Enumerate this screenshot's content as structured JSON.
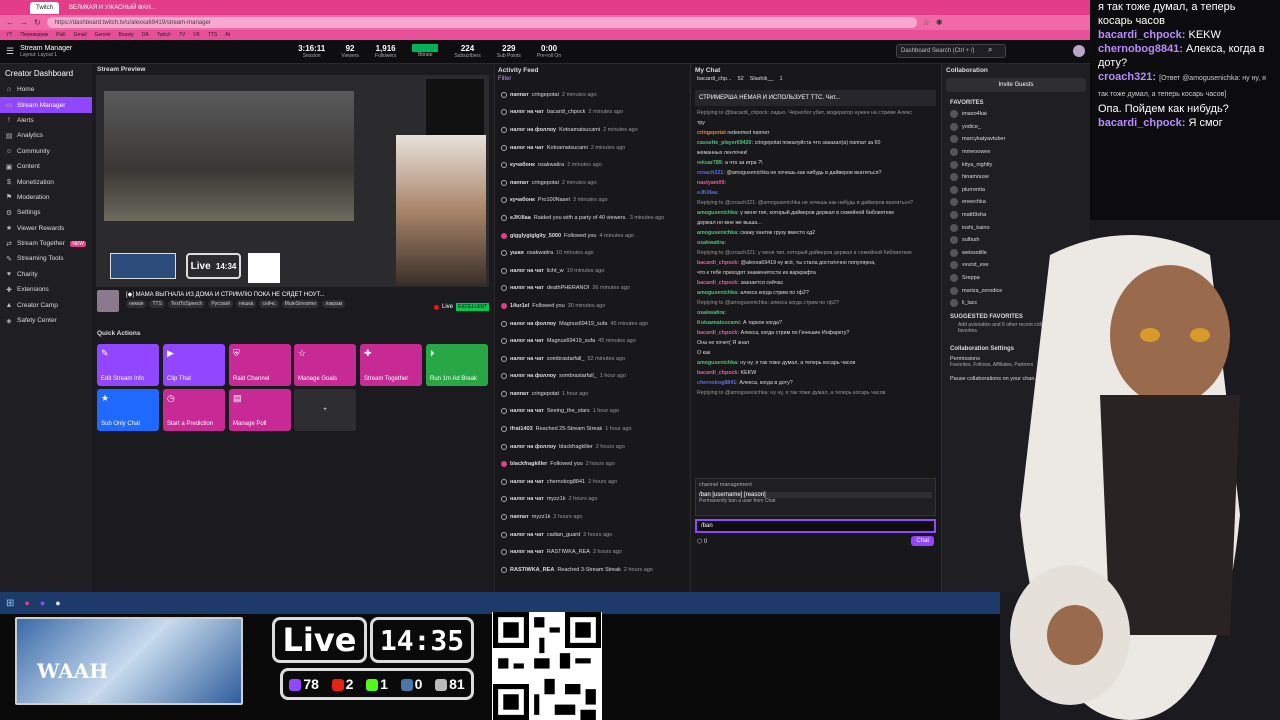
{
  "browser": {
    "tabs": [
      {
        "label": "Twitch",
        "active": true
      },
      {
        "label": "ВЕЛИКАЯ И УЖАСНЫЙ ФАН…",
        "active": false
      }
    ],
    "url": "https://dashboard.twitch.tv/u/alexxa69419/stream-manager",
    "bookmarks": [
      "YT",
      "Переводчик",
      "PoE",
      "Gmail",
      "Gemini",
      "Boosty",
      "DA",
      "Twitch",
      "TV",
      "VK",
      "TTS",
      "AI"
    ]
  },
  "topbar": {
    "title": "Stream Manager",
    "subtitle": "Layout: Layout 1",
    "stats": [
      {
        "value": "3:16:11",
        "label": "Session"
      },
      {
        "value": "92",
        "label": "Viewers"
      },
      {
        "value": "1,916",
        "label": "Followers"
      },
      {
        "value": "",
        "label": "Bitrate"
      },
      {
        "value": "224",
        "label": "Subscribers"
      },
      {
        "value": "229",
        "label": "Sub Points"
      },
      {
        "value": "0:00",
        "label": "Pre-roll On"
      }
    ],
    "search_placeholder": "Dashboard Search (Ctrl + /)"
  },
  "sidebar": {
    "title": "Creator Dashboard",
    "items": [
      {
        "label": "Home",
        "icon": "home-icon"
      },
      {
        "label": "Stream Manager",
        "icon": "stream-manager-icon",
        "active": true
      },
      {
        "label": "Alerts",
        "icon": "alerts-icon"
      },
      {
        "label": "Analytics",
        "icon": "analytics-icon"
      },
      {
        "label": "Community",
        "icon": "community-icon"
      },
      {
        "label": "Content",
        "icon": "content-icon"
      },
      {
        "label": "Monetization",
        "icon": "monetization-icon"
      },
      {
        "label": "Moderation",
        "icon": "moderation-icon"
      },
      {
        "label": "Settings",
        "icon": "settings-icon"
      },
      {
        "label": "Viewer Rewards",
        "icon": "rewards-icon"
      },
      {
        "label": "Stream Together",
        "icon": "stream-together-icon",
        "badge": "NEW"
      },
      {
        "label": "Streaming Tools",
        "icon": "tools-icon"
      },
      {
        "label": "Charity",
        "icon": "charity-icon"
      },
      {
        "label": "Extensions",
        "icon": "extensions-icon"
      },
      {
        "label": "Creator Camp",
        "icon": "camp-icon"
      },
      {
        "label": "Safety Center",
        "icon": "safety-icon"
      }
    ]
  },
  "preview": {
    "header": "Stream Preview",
    "stream_title": "[◆] МАМА ВЫГНАЛА ИЗ ДОМА И СТРИМЛЮ ПОКА НЕ СЯДЕТ НОУТ...",
    "tags": [
      "немая",
      "TTS",
      "TextToSpeech",
      "Русский",
      "няшка",
      "сейчс",
      "MuteStreamer",
      "лакрам"
    ],
    "live_label": "Live",
    "quality": "EXCELLENT"
  },
  "quick_actions": {
    "header": "Quick Actions",
    "items": [
      {
        "label": "Edit Stream Info",
        "color": "#9147ff"
      },
      {
        "label": "Clip That",
        "color": "#9147ff"
      },
      {
        "label": "Raid Channel",
        "color": "#c72a94"
      },
      {
        "label": "Manage Goals",
        "color": "#c72a94"
      },
      {
        "label": "Stream Together",
        "color": "#c72a94"
      },
      {
        "label": "Run 1m Ad Break",
        "color": "#28a745"
      },
      {
        "label": "Sub Only Chat",
        "color": "#1f69ff"
      },
      {
        "label": "Start a Prediction",
        "color": "#c72a94"
      },
      {
        "label": "Manage Poll",
        "color": "#c72a94"
      },
      {
        "label": "+",
        "color": "#2e2e32"
      }
    ]
  },
  "activity": {
    "header": "Activity Feed",
    "filter": "Filter",
    "rows": [
      {
        "user": "паппат",
        "text": "cringepotat",
        "time": "2 minutes ago",
        "heart": false
      },
      {
        "user": "налог на чат",
        "text": "bacardi_chpock",
        "time": "2 minutes ago",
        "heart": false
      },
      {
        "user": "налог на фоллоу",
        "text": "Kotoamatsucami",
        "time": "2 minutes ago",
        "heart": false
      },
      {
        "user": "налог на чат",
        "text": "Kotoamatsucami",
        "time": "2 minutes ago",
        "heart": false
      },
      {
        "user": "кучабонк",
        "text": "osakwatira",
        "time": "2 minutes ago",
        "heart": false
      },
      {
        "user": "паппат",
        "text": "cringepotat",
        "time": "2 minutes ago",
        "heart": false
      },
      {
        "user": "кучабонк",
        "text": "Pro100Naset",
        "time": "3 minutes ago",
        "heart": false
      },
      {
        "user": "eJKillaa",
        "text": "Raided you with a party of 40 viewers.",
        "time": "3 minutes ago",
        "heart": false
      },
      {
        "user": "gigglygiglgity_5000",
        "text": "Followed you",
        "time": "4 minutes ago",
        "heart": true
      },
      {
        "user": "ушки",
        "text": "osakwatira",
        "time": "10 minutes ago",
        "heart": false
      },
      {
        "user": "налог на чат",
        "text": "licht_w",
        "time": "19 minutes ago",
        "heart": false
      },
      {
        "user": "налог на чат",
        "text": "deathPHERANOI",
        "time": "26 minutes ago",
        "heart": false
      },
      {
        "user": "14ur1el",
        "text": "Followed you",
        "time": "30 minutes ago",
        "heart": true
      },
      {
        "user": "налог на фоллоу",
        "text": "Magnus69419_sufa",
        "time": "45 minutes ago",
        "heart": false
      },
      {
        "user": "налог на чат",
        "text": "Magnus69419_sufa",
        "time": "45 minutes ago",
        "heart": false
      },
      {
        "user": "налог на чат",
        "text": "sombrastarfall_",
        "time": "52 minutes ago",
        "heart": false
      },
      {
        "user": "налог на фоллоу",
        "text": "sombrastarfall_",
        "time": "1 hour ago",
        "heart": false
      },
      {
        "user": "паппат",
        "text": "cringepotat",
        "time": "1 hour ago",
        "heart": false
      },
      {
        "user": "налог на чат",
        "text": "Seeing_the_stars",
        "time": "1 hour ago",
        "heart": false
      },
      {
        "user": "ifrat1403",
        "text": "Reached 25-Stream Streak",
        "time": "1 hour ago",
        "heart": false
      },
      {
        "user": "налог на фоллоу",
        "text": "blackfragkiller",
        "time": "2 hours ago",
        "heart": false
      },
      {
        "user": "blackfragkiller",
        "text": "Followed you",
        "time": "2 hours ago",
        "heart": true
      },
      {
        "user": "налог на чат",
        "text": "chernobog8841",
        "time": "2 hours ago",
        "heart": false
      },
      {
        "user": "налог на чат",
        "text": "myzz1k",
        "time": "2 hours ago",
        "heart": false
      },
      {
        "user": "паппат",
        "text": "myzz1k",
        "time": "2 hours ago",
        "heart": false
      },
      {
        "user": "налог на чат",
        "text": "cadian_guard",
        "time": "2 hours ago",
        "heart": false
      },
      {
        "user": "налог на чат",
        "text": "RASTIWKA_REA",
        "time": "2 hours ago",
        "heart": false
      },
      {
        "user": "RASTIWKA_REA",
        "text": "Reached 3-Stream Streak",
        "time": "2 hours ago",
        "heart": false
      }
    ]
  },
  "chat": {
    "header": "My Chat",
    "pinned": "СТРИМЕРША НЕМАЯ И ИСПОЛЬЗУЕТ ТТС. Чит...",
    "top_users": [
      "bacardi_chp...",
      "52",
      "Slashik__",
      "1"
    ],
    "lines": [
      {
        "user": "",
        "text": "Replying to @bacardi_chpock: ладно. Чернобог убит, модератор нужен на стриме Алекс"
      },
      {
        "user": "",
        "text": "тру"
      },
      {
        "user": "cringepotat",
        "text": "redeemed паппат",
        "cls": "u-o"
      },
      {
        "user": "cassette_player69420:",
        "text": "cringepotat пожалуйста что заказал(а) паппат за 60",
        "cls": "u-g"
      },
      {
        "user": "",
        "text": "жеманных ленточек!"
      },
      {
        "user": "reksar789:",
        "text": "а что за игра ?\\",
        "cls": "u-g"
      },
      {
        "user": "croach321:",
        "text": "@amogusenichka не хочешь как нибудь в дайверов вкатиться?",
        "cls": "u-b"
      },
      {
        "user": "nastyam09:",
        "text": "",
        "cls": "u-p"
      },
      {
        "user": "eJKillaa:",
        "text": "",
        "cls": "u-b"
      },
      {
        "user": "",
        "text": "Replying to @croach321: @amogusenichka не хочешь как нибудь в дайверов вкатиться?"
      },
      {
        "user": "amogusenichka:",
        "text": "у меня тип, который дайверов держал в семейной библиотеке",
        "cls": "u-g"
      },
      {
        "user": "",
        "text": "держал но мне же выша..."
      },
      {
        "user": "amogusenichka:",
        "text": "скажу хантик грузу вместо хд2",
        "cls": "u-g"
      },
      {
        "user": "osakwatira:",
        "text": "",
        "cls": "u-g"
      },
      {
        "user": "",
        "text": "Replying to @croach321: у меня тип, который дайверов держал в семейной библиотеке"
      },
      {
        "user": "bacardi_chpock:",
        "text": "@alexxa69419 ну всё, ты стала достаточно популярна,",
        "cls": "u-p"
      },
      {
        "user": "",
        "text": "что к тебе приходят знаменитости из варкрафта"
      },
      {
        "user": "bacardi_chpock:",
        "text": "зазнается сейчас",
        "cls": "u-p"
      },
      {
        "user": "amogusenichka:",
        "text": "алекса когда стрим по гф2?",
        "cls": "u-g"
      },
      {
        "user": "",
        "text": "Replying to @amogusenichka: алекса когда стрим по гф2?"
      },
      {
        "user": "osakwatira:",
        "text": "",
        "cls": "u-g"
      },
      {
        "user": "Kotoamatsucami:",
        "text": "А таркое когда?",
        "cls": "u-g"
      },
      {
        "user": "bacardi_chpock:",
        "text": "Алекса, когда стрим по Генешин Инфаркту?",
        "cls": "u-p"
      },
      {
        "user": "",
        "text": "Она не хочет( Я знал"
      },
      {
        "user": "",
        "text": "О как"
      },
      {
        "user": "amogusenichka:",
        "text": "ну ну, я так тоже думал, а теперь косарь часов",
        "cls": "u-g"
      },
      {
        "user": "bacardi_chpock:",
        "text": "KEKW",
        "cls": "u-p"
      },
      {
        "user": "chernobog8841:",
        "text": "Алекса, когда в доту?",
        "cls": "u-b"
      },
      {
        "user": "",
        "text": "Replying to @amogusenichka: ну ну, я так тоже думал, а теперь косарь часов"
      }
    ],
    "suggest_header": "channel management",
    "suggest_cmd": "/ban [username] [reason]",
    "suggest_desc": "Permanently ban a user from Chat",
    "input_value": "/ban",
    "chat_button": "Chat",
    "points": "0"
  },
  "collab": {
    "header": "Collaboration",
    "invite": "Invite Guests",
    "fav_header": "FAVORITES",
    "favorites": [
      "imaxo4kai",
      "yodice_",
      "marcykatyavtuber",
      "mmeoowee",
      "kitya_nightly",
      "hinamouse",
      "plurrentia",
      "eneechka",
      "mattt9sha",
      "ioshi_kaino",
      "sulfash",
      "weissstille",
      "vvurst_exe",
      "Sreppa",
      "mariza_zerodice",
      "li_lacc"
    ],
    "suggested_header": "SUGGESTED FAVORITES",
    "suggested_text": "Add avioriakko and 9 other recent collaborators as favorites.",
    "settings_header": "Collaboration Settings",
    "permissions": "Permissions",
    "permissions_sub": "Favorites, Follows, Affiliates, Partners",
    "pause": "Pause collaborations on your chan..."
  },
  "overlay_chat": {
    "lines": [
      {
        "user": "",
        "text": "я так тоже думал, а теперь косарь часов"
      },
      {
        "user": "bacardi_chpock:",
        "text": "KEKW"
      },
      {
        "user": "chernobog8841:",
        "text": "Алекса, когда в доту?"
      },
      {
        "user": "croach321:",
        "text": "[Ответ @amogusenichka: ну ну, я так тоже думал, а теперь косарь часов]"
      },
      {
        "user": "",
        "text": "Опа. Пойдем как нибудь?"
      },
      {
        "user": "bacardi_chpock:",
        "text": "Я смог"
      }
    ]
  },
  "stream_overlay": {
    "live": "Live",
    "clock": "14:35",
    "mini_live": "Live",
    "mini_clock": "14:34",
    "webcam_label": "WAAH",
    "counters": [
      {
        "value": "78",
        "color": "#9147ff",
        "icon": "twitch-icon"
      },
      {
        "value": "2",
        "color": "#e62117",
        "icon": "youtube-icon"
      },
      {
        "value": "1",
        "color": "#53fc18",
        "icon": "kick-icon"
      },
      {
        "value": "0",
        "color": "#4a76a8",
        "icon": "vk-icon"
      },
      {
        "value": "81",
        "color": "#bbbbbb",
        "icon": "total-icon"
      }
    ]
  }
}
